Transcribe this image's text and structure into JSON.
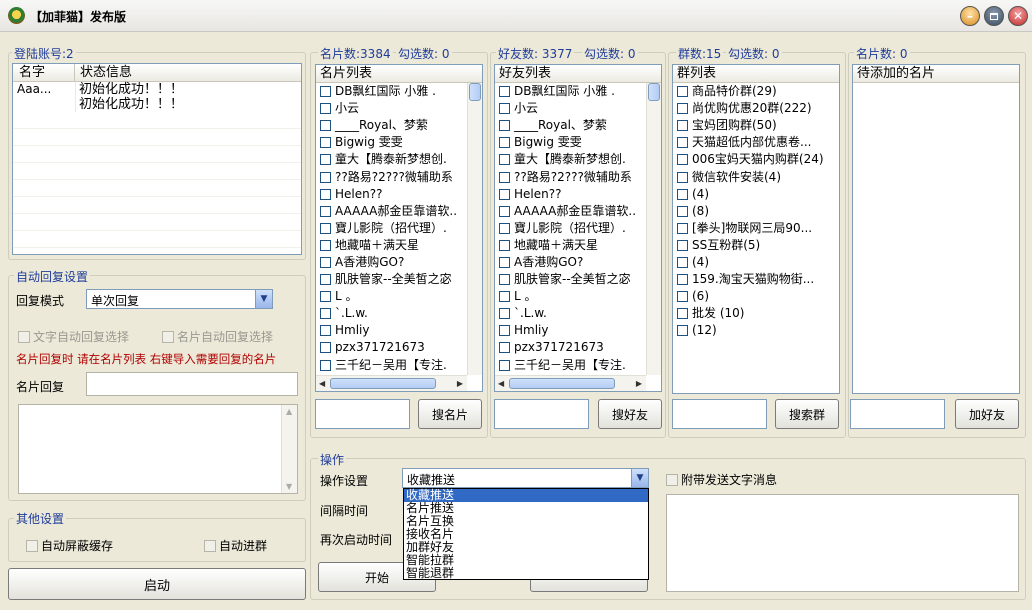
{
  "window": {
    "title": "【加菲猫】发布版"
  },
  "login": {
    "group_label": "登陆账号:2",
    "columns": [
      "名字",
      "状态信息"
    ],
    "rows": [
      {
        "name": "Aaa...",
        "status": "初始化成功！！！"
      },
      {
        "name": "",
        "status": "初始化成功！！！"
      }
    ]
  },
  "auto_reply": {
    "group_label": "自动回复设置",
    "mode_label": "回复模式",
    "mode_value": "单次回复",
    "text_auto_reply": "文字自动回复选择",
    "card_auto_reply": "名片自动回复选择",
    "note": "名片回复时 请在名片列表 右键导入需要回复的名片",
    "card_reply_label": "名片回复",
    "card_reply_value": ""
  },
  "other": {
    "group_label": "其他设置",
    "auto_block_cache": "自动屏蔽缓存",
    "auto_join_group": "自动进群"
  },
  "start_button": "启动",
  "cards": {
    "count_label": "名片数:3384",
    "selected_label": "勾选数: 0",
    "header": "名片列表",
    "items": [
      "DB飘红国际   小雅 .",
      "小云",
      "____Royal、梦萦",
      "Bigwig  雯雯",
      "童大【腾泰新梦想创.",
      "??路易?2???微辅助系",
      "Helen??",
      "AAAAA郝金臣靠谱软..",
      "寶儿影院（招代理）.",
      "地藏喵＋满天星",
      "A香港购GO?",
      "肌肤管家--全美皙之宓",
      "L 。",
      "`.L.w.",
      "Hmliy",
      "pzx371721673",
      "三千纪－吴用【专注."
    ],
    "search_input": "",
    "search_button": "搜名片"
  },
  "friends": {
    "count_label": "好友数: 3377",
    "selected_label": "勾选数: 0",
    "header": "好友列表",
    "items": [
      "DB飘红国际   小雅 .",
      "小云",
      "____Royal、梦萦",
      "Bigwig  雯雯",
      "童大【腾泰新梦想创.",
      "??路易?2???微辅助系",
      "Helen??",
      "AAAAA郝金臣靠谱软..",
      "寶儿影院（招代理）.",
      "地藏喵＋满天星",
      "A香港购GO?",
      "肌肤管家--全美皙之宓",
      "L 。",
      "`.L.w.",
      "Hmliy",
      "pzx371721673",
      "三千纪－吴用【专注."
    ],
    "search_input": "",
    "search_button": "搜好友"
  },
  "groups": {
    "count_label": "群数:15",
    "selected_label": "勾选数: 0",
    "header": "群列表",
    "items": [
      "商品特价群(29)",
      "尚优购优惠20群(222)",
      "宝妈团购群(50)",
      "天猫超低内部优惠卷...",
      "006宝妈天猫内购群(24)",
      "微信软件安装(4)",
      "(4)",
      "(8)",
      "[拳头]物联网三局90...",
      "SS互粉群(5)",
      "(4)",
      "159.淘宝天猫购物街...",
      "(6)",
      "批发  (10)",
      "(12)"
    ],
    "search_input": "",
    "search_button": "搜索群"
  },
  "pending": {
    "count_label": "名片数: 0",
    "header": "待添加的名片",
    "search_input": "",
    "add_button": "加好友"
  },
  "operation": {
    "group_label": "操作",
    "setting_label": "操作设置",
    "setting_value": "收藏推送",
    "options": [
      "收藏推送",
      "名片推送",
      "名片互换",
      "接收名片",
      "加群好友",
      "智能拉群",
      "智能退群"
    ],
    "interval_label": "间隔时间",
    "restart_label": "再次启动时间",
    "attach_text": "附带发送文字消息",
    "start_button": "开始",
    "message_value": ""
  }
}
